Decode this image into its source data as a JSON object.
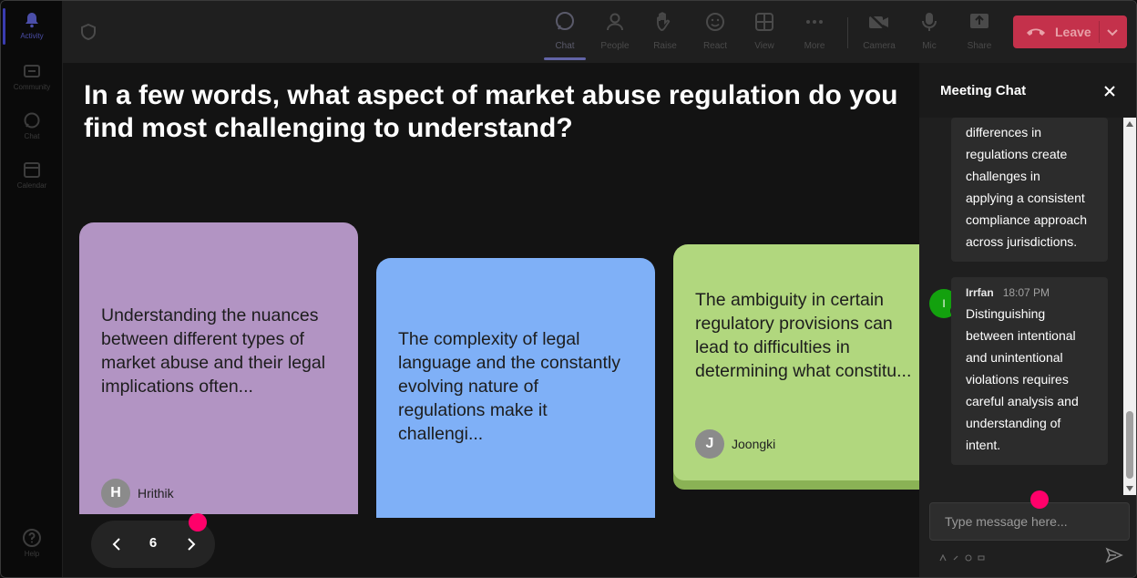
{
  "rail": {
    "items": [
      {
        "label": "Activity",
        "icon": "bell-icon"
      },
      {
        "label": "Community",
        "icon": "community-icon"
      },
      {
        "label": "Chat",
        "icon": "chat-icon"
      },
      {
        "label": "Calendar",
        "icon": "calendar-icon"
      },
      {
        "label": "Help",
        "icon": "help-icon"
      }
    ]
  },
  "toolbar": {
    "chat": "Chat",
    "people": "People",
    "raise": "Raise",
    "react": "React",
    "view": "View",
    "more": "More",
    "camera": "Camera",
    "mic": "Mic",
    "share": "Share",
    "leave": "Leave"
  },
  "stage": {
    "question": "In a few words, what aspect of market abuse regulation do you find most challenging to understand?",
    "cards": [
      {
        "text": "Understanding the nuances\nbetween different types of\nmarket abuse and their legal\nimplications often...",
        "author": "Hrithik",
        "initial": "H",
        "color": "#b294c3"
      },
      {
        "text": "The complexity of legal\nlanguage and the constantly\nevolving nature of\nregulations make it\nchallengi...",
        "author": "",
        "initial": "",
        "color": "#7fb0f7"
      },
      {
        "text": "The ambiguity in certain\nregulatory provisions can\nlead to difficulties in\ndetermining what constitu...",
        "author": "Joongki",
        "initial": "J",
        "color": "#b1d77e"
      }
    ],
    "page": "6"
  },
  "chat": {
    "title": "Meeting Chat",
    "messages": [
      {
        "text": "differences in\nregulations create\nchallenges in\napplying a consistent\ncompliance approach\nacross jurisdictions."
      },
      {
        "author": "Irrfan",
        "time": "18:07 PM",
        "initial": "I",
        "text": "Distinguishing\nbetween intentional\nand unintentional\nviolations requires\ncareful analysis and\nunderstanding of\nintent."
      }
    ],
    "input_placeholder": "Type message here..."
  },
  "colors": {
    "accent": "#6264a7",
    "leave": "#c4314b",
    "marker": "#ff006a",
    "avatar_green": "#13a10e"
  }
}
